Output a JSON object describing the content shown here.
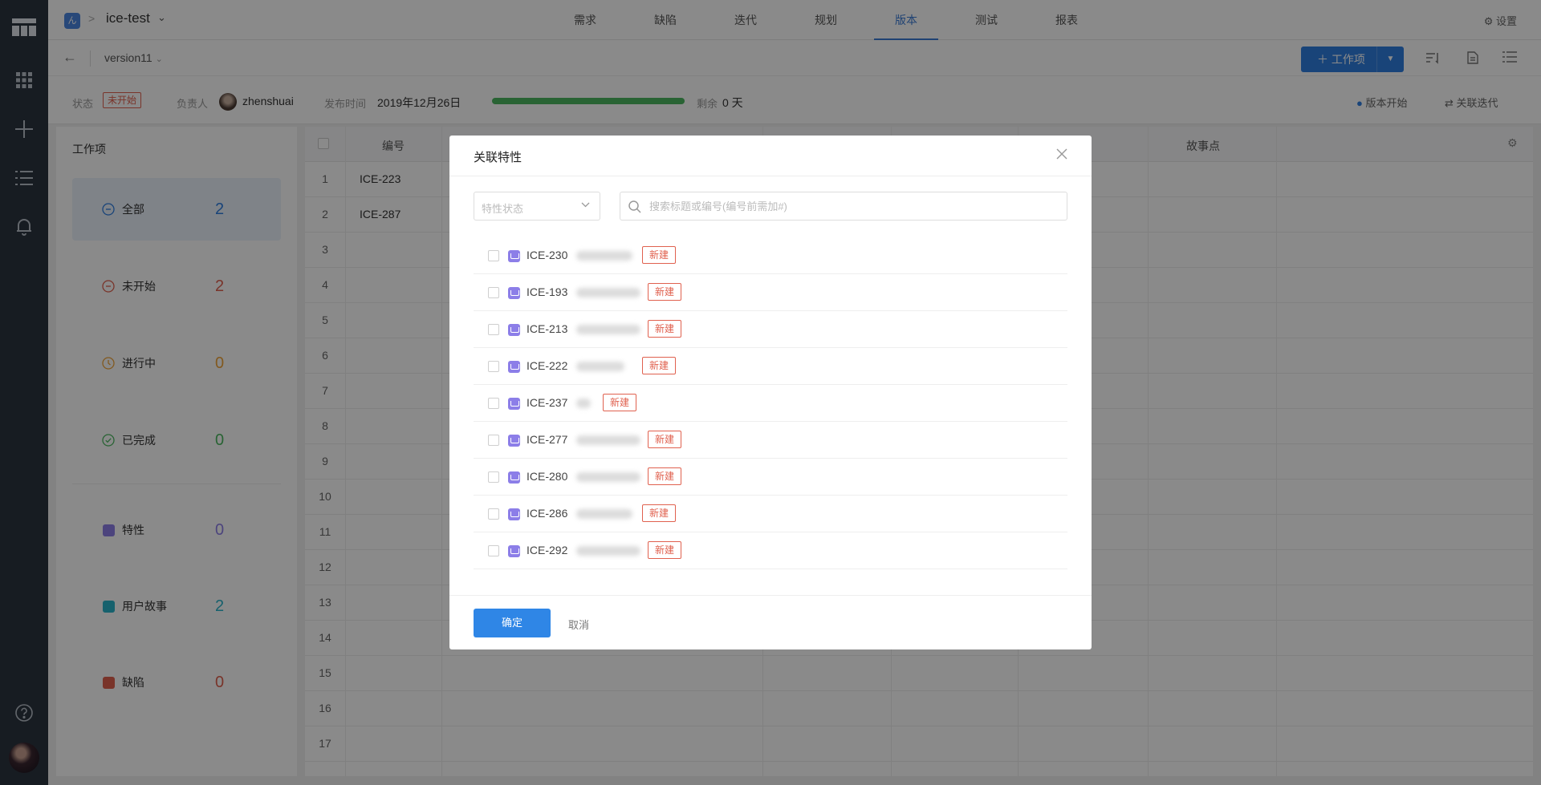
{
  "project": {
    "name": "ice-test"
  },
  "nav": {
    "items": [
      "需求",
      "缺陷",
      "迭代",
      "规划",
      "版本",
      "测试",
      "报表"
    ],
    "active": "版本"
  },
  "settings_label": "设置",
  "version": {
    "name": "version11"
  },
  "toolbar": {
    "add_label": "工作项"
  },
  "info": {
    "status_label": "状态",
    "status_value": "未开始",
    "owner_label": "负责人",
    "owner_value": "zhenshuai",
    "release_label": "发布时间",
    "release_value": "2019年12月26日",
    "progress": 1.0,
    "remaining_label": "剩余",
    "remaining_value": "0 天",
    "start_action": "版本开始",
    "link_action": "关联迭代"
  },
  "left_panel": {
    "title": "工作项",
    "status_items": [
      {
        "label": "全部",
        "count": "2",
        "color": "#2f7ee0"
      },
      {
        "label": "未开始",
        "count": "2",
        "color": "#e0614f"
      },
      {
        "label": "进行中",
        "count": "0",
        "color": "#f0a43a"
      },
      {
        "label": "已完成",
        "count": "0",
        "color": "#4cb860"
      }
    ],
    "type_items": [
      {
        "label": "特性",
        "count": "0",
        "color": "#8c7ee8"
      },
      {
        "label": "用户故事",
        "count": "2",
        "color": "#2ab3c9"
      },
      {
        "label": "缺陷",
        "count": "0",
        "color": "#e0614f"
      }
    ]
  },
  "table": {
    "col_code": "编号",
    "col_story_points": "故事点",
    "rows": [
      {
        "idx": "1",
        "code": "ICE-223"
      },
      {
        "idx": "2",
        "code": "ICE-287"
      },
      {
        "idx": "3",
        "code": ""
      },
      {
        "idx": "4",
        "code": ""
      },
      {
        "idx": "5",
        "code": ""
      },
      {
        "idx": "6",
        "code": ""
      },
      {
        "idx": "7",
        "code": ""
      },
      {
        "idx": "8",
        "code": ""
      },
      {
        "idx": "9",
        "code": ""
      },
      {
        "idx": "10",
        "code": ""
      },
      {
        "idx": "11",
        "code": ""
      },
      {
        "idx": "12",
        "code": ""
      },
      {
        "idx": "13",
        "code": ""
      },
      {
        "idx": "14",
        "code": ""
      },
      {
        "idx": "15",
        "code": ""
      },
      {
        "idx": "16",
        "code": ""
      },
      {
        "idx": "17",
        "code": ""
      }
    ]
  },
  "modal": {
    "title": "关联特性",
    "status_placeholder": "特性状态",
    "search_placeholder": "搜索标题或编号(编号前需加#)",
    "items": [
      {
        "code": "ICE-230",
        "status": "新建"
      },
      {
        "code": "ICE-193",
        "status": "新建"
      },
      {
        "code": "ICE-213",
        "status": "新建"
      },
      {
        "code": "ICE-222",
        "status": "新建"
      },
      {
        "code": "ICE-237",
        "status": "新建"
      },
      {
        "code": "ICE-277",
        "status": "新建"
      },
      {
        "code": "ICE-280",
        "status": "新建"
      },
      {
        "code": "ICE-286",
        "status": "新建"
      },
      {
        "code": "ICE-292",
        "status": "新建"
      }
    ],
    "confirm_label": "确定",
    "cancel_label": "取消"
  }
}
